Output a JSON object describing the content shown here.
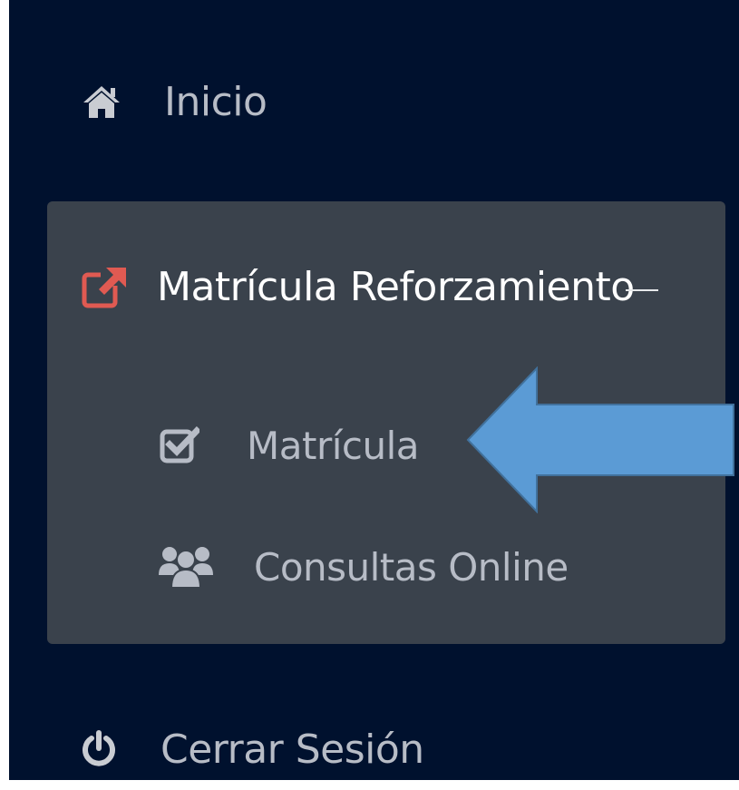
{
  "sidebar": {
    "items": [
      {
        "label": "Inicio",
        "icon": "home-icon"
      },
      {
        "label": "Matrícula Reforzamiento",
        "icon": "external-link-icon",
        "accent_color": "#e05a52",
        "expanded": true
      },
      {
        "label": "Cerrar Sesión",
        "icon": "power-icon"
      }
    ],
    "submenu": [
      {
        "label": "Matrícula",
        "icon": "check-square-icon"
      },
      {
        "label": "Consultas Online",
        "icon": "users-icon"
      }
    ]
  },
  "annotation": {
    "icon": "arrow-left-icon",
    "color": "#5b9bd5"
  },
  "colors": {
    "sidebar_bg": "#00112e",
    "submenu_bg": "#3a424c",
    "text": "#b7bcc6",
    "active_text": "#ffffff"
  }
}
